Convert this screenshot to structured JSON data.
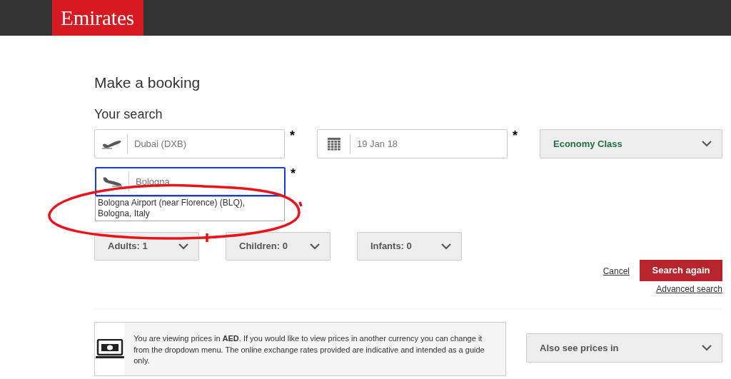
{
  "header": {
    "logo": "Emirates"
  },
  "title": "Make a booking",
  "section_title": "Your search",
  "route_fields": [
    {
      "kind": "departure",
      "value": "Dubai (DXB)",
      "required_mark": "*",
      "focused": false
    },
    {
      "kind": "arrival",
      "value": "Bologna",
      "required_mark": "*",
      "focused": true
    }
  ],
  "date_field": {
    "value": "19 Jan 18",
    "required_mark": "*"
  },
  "cabin_select": {
    "value": "Economy Class"
  },
  "autocomplete": {
    "suggestion": "Bologna Airport (near Florence) (BLQ), Bologna, Italy"
  },
  "passengers": [
    "Adults: 1",
    "Children: 0",
    "Infants: 0"
  ],
  "actions": {
    "cancel": "Cancel",
    "search": "Search again",
    "advanced": "Advanced search"
  },
  "currency_info": {
    "text": "You are viewing prices in **AED**. If you would like to view prices in another currency you can change it from the dropdown menu. The online exchange rates provided are indicative and intended as a guide only.",
    "select": "Also see prices in"
  },
  "annotation": {
    "kind": "ellipse",
    "color": "#e8141b"
  }
}
